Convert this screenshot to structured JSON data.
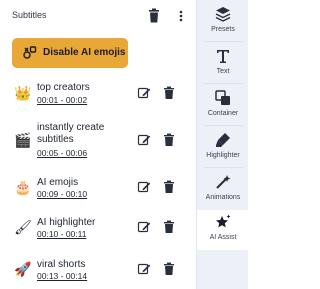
{
  "panel": {
    "title": "Subtitles",
    "cta_label": "Disable AI emojis"
  },
  "items": [
    {
      "emoji": "👑",
      "name": "top creators",
      "time": "00:01 - 00:02"
    },
    {
      "emoji": "🎬",
      "name": "instantly create subtitles",
      "time": "00:05 - 00:06"
    },
    {
      "emoji": "🎂",
      "name": "AI emojis",
      "time": "00:09 - 00:10"
    },
    {
      "emoji": "🖌",
      "name": "AI highlighter",
      "time": "00:10 - 00:11"
    },
    {
      "emoji": "🚀",
      "name": "viral shorts",
      "time": "00:13 - 00:14"
    }
  ],
  "rail": [
    {
      "label": "Presets",
      "icon": "presets-icon"
    },
    {
      "label": "Text",
      "icon": "text-icon"
    },
    {
      "label": "Container",
      "icon": "container-icon"
    },
    {
      "label": "Highlighter",
      "icon": "highlighter-icon"
    },
    {
      "label": "Animations",
      "icon": "animations-icon"
    },
    {
      "label": "AI Assist",
      "icon": "ai-assist-icon"
    }
  ],
  "colors": {
    "accent": "#e9a738",
    "rail_bg": "#eef0f8",
    "active_tab_bg": "#ffffff"
  }
}
